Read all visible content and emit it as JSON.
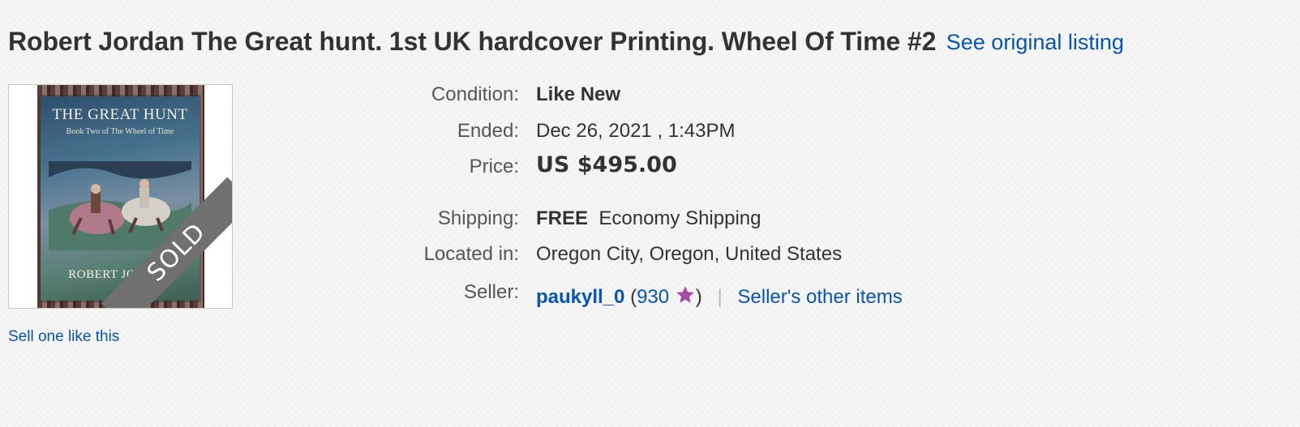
{
  "listing": {
    "title": "Robert Jordan The Great hunt. 1st UK hardcover Printing. Wheel Of Time #2",
    "original_link": "See original listing"
  },
  "image": {
    "cover_title": "THE GREAT HUNT",
    "cover_subtitle": "Book Two of The Wheel of Time",
    "cover_author": "ROBERT JORDAN",
    "sold_label": "SOLD"
  },
  "sell_link": "Sell one like this",
  "details": {
    "condition": {
      "label": "Condition:",
      "value": "Like New"
    },
    "ended": {
      "label": "Ended:",
      "value": "Dec 26, 2021 , 1:43PM"
    },
    "price": {
      "label": "Price:",
      "value": "US $495.00"
    },
    "shipping": {
      "label": "Shipping:",
      "free": "FREE",
      "method": "Economy Shipping"
    },
    "located": {
      "label": "Located in:",
      "value": "Oregon City, Oregon, United States"
    },
    "seller": {
      "label": "Seller:",
      "name": "paukyll_0",
      "open_paren": "(",
      "score": "930",
      "close_paren": ")",
      "separator": "|",
      "other_items": "Seller's other items"
    }
  },
  "colors": {
    "link": "#0654ba",
    "star": "#a64ca6",
    "sold_ribbon": "#707070"
  }
}
